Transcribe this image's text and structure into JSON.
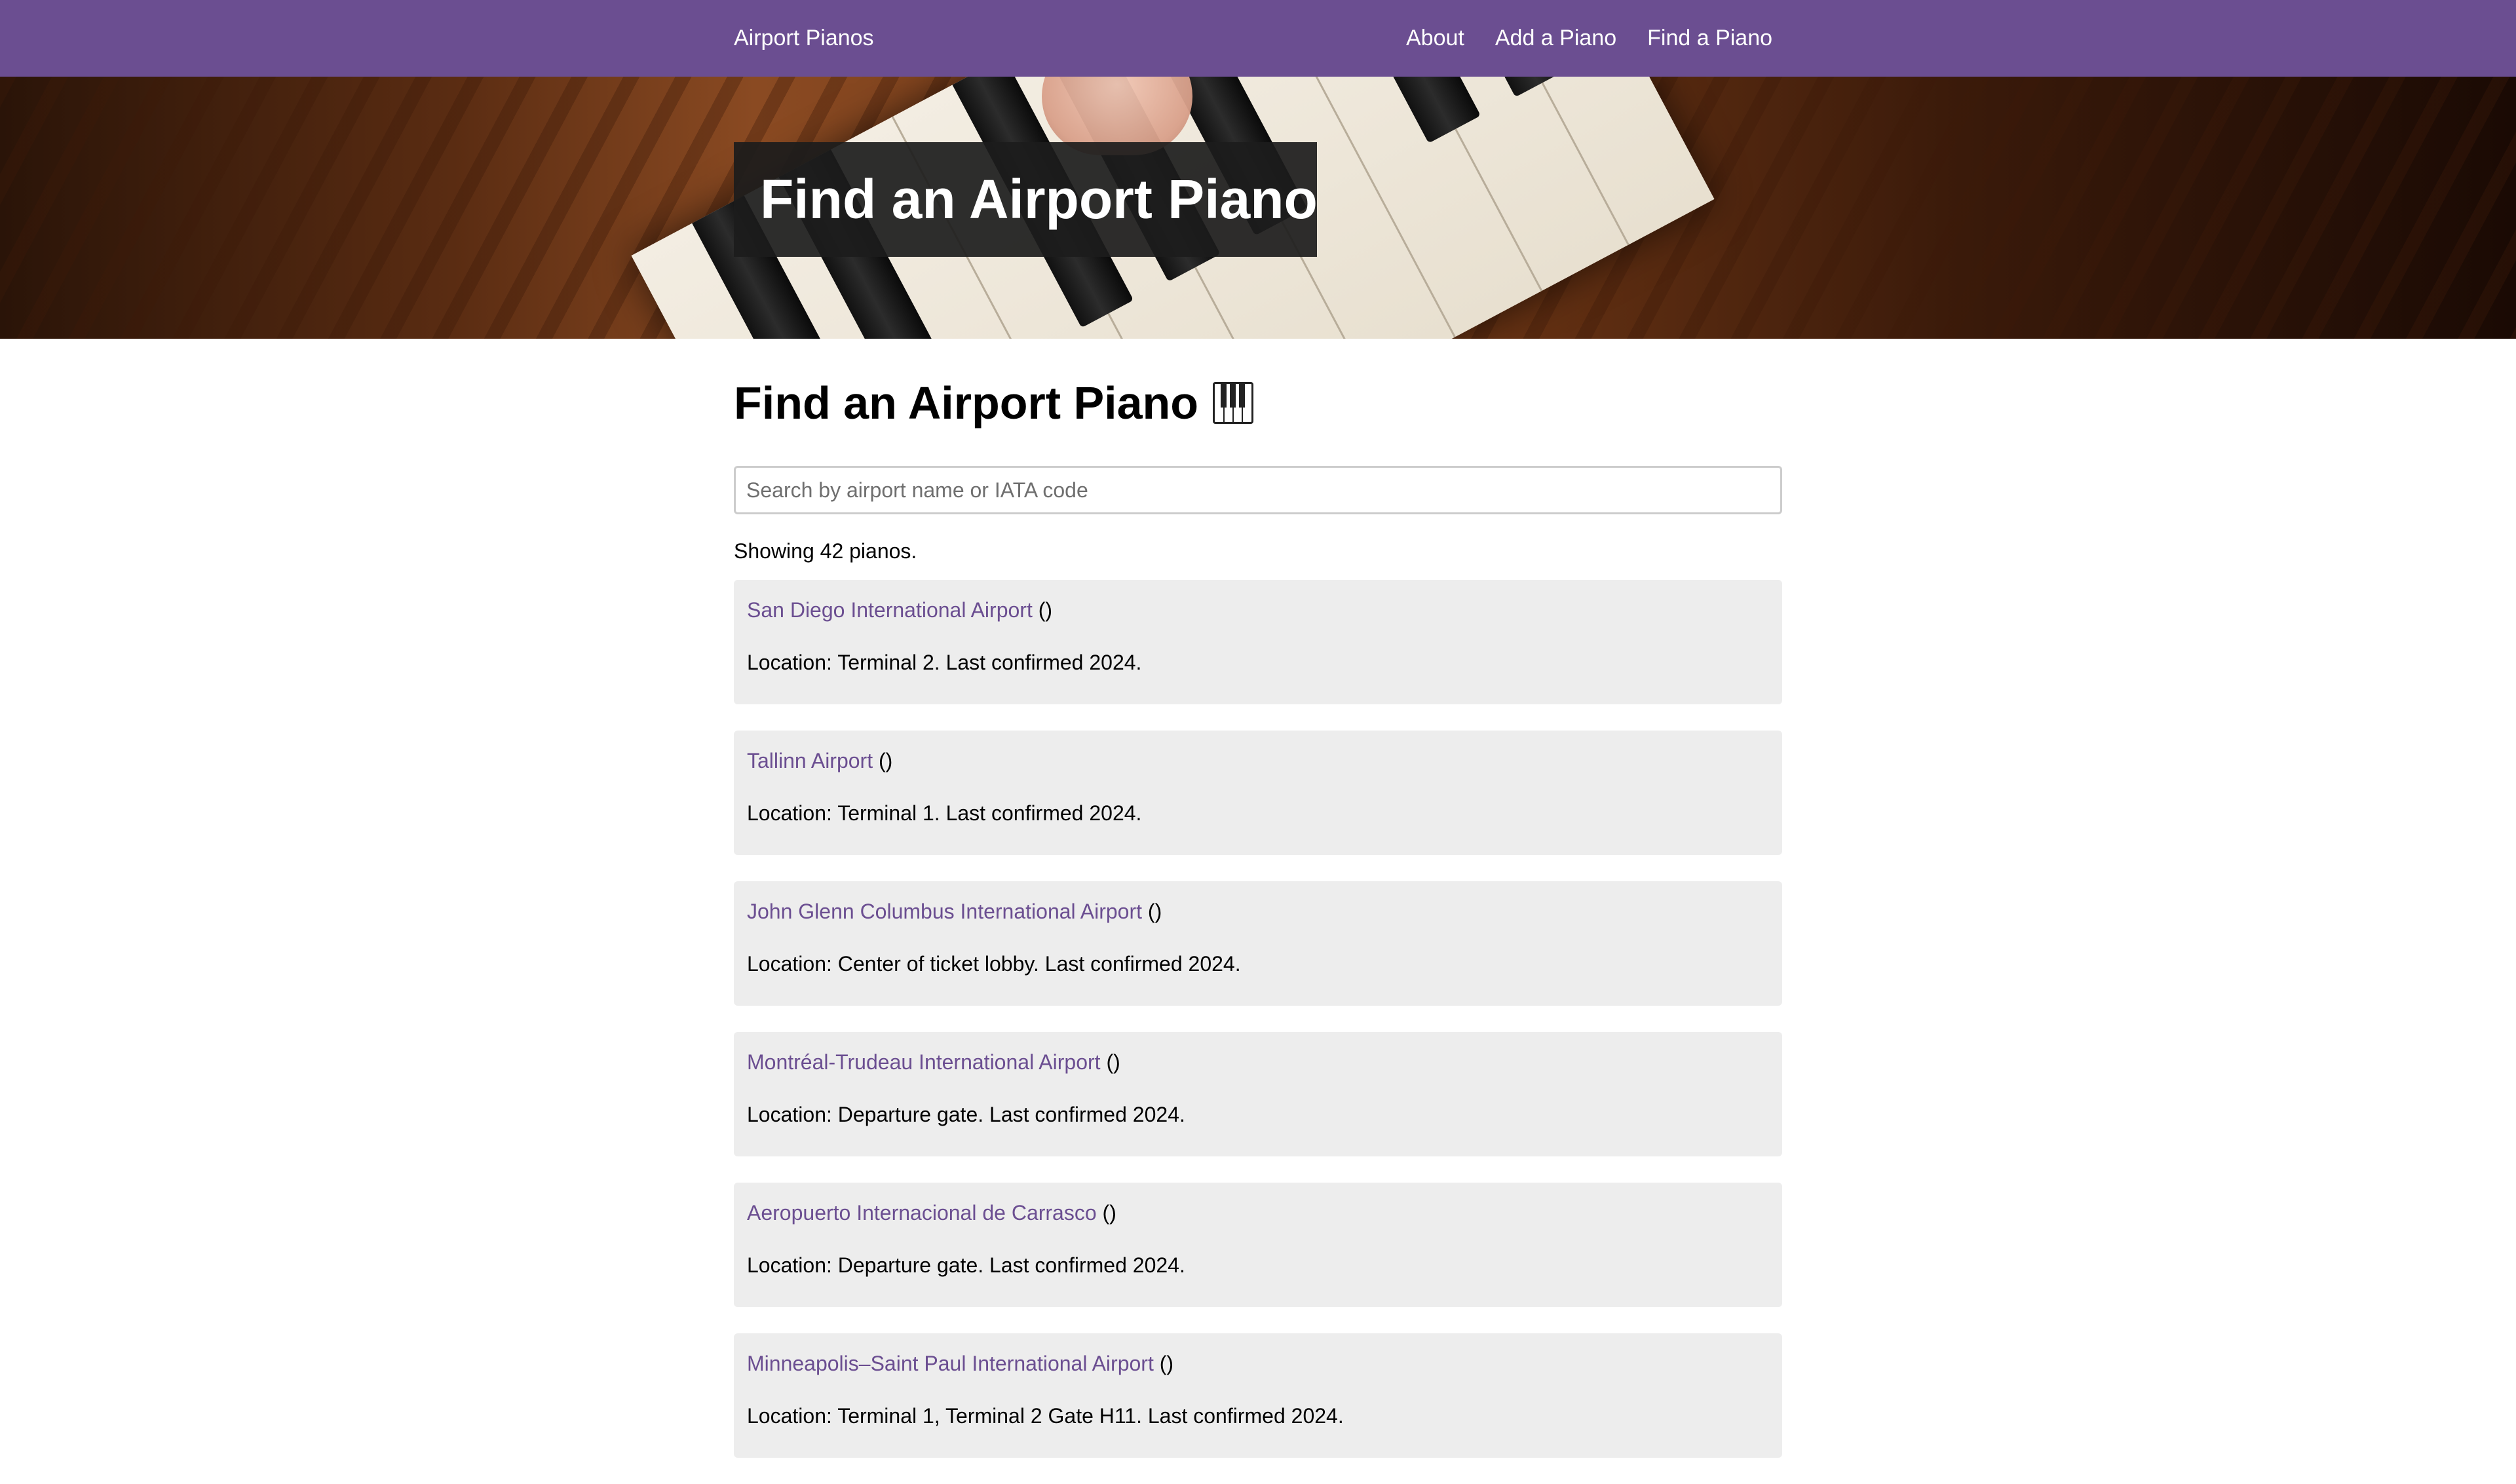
{
  "nav": {
    "brand": "Airport Pianos",
    "links": [
      {
        "label": "About"
      },
      {
        "label": "Add a Piano"
      },
      {
        "label": "Find a Piano"
      }
    ]
  },
  "hero": {
    "title": "Find an Airport Piano"
  },
  "main": {
    "title": "Find an Airport Piano",
    "title_icon": "piano-keys-icon",
    "search": {
      "placeholder": "Search by airport name or IATA code",
      "value": ""
    },
    "results_text": "Showing 42 pianos.",
    "pianos": [
      {
        "name": "San Diego International Airport",
        "code": "()",
        "location": "Location: Terminal 2. Last confirmed 2024."
      },
      {
        "name": "Tallinn Airport",
        "code": "()",
        "location": "Location: Terminal 1. Last confirmed 2024."
      },
      {
        "name": "John Glenn Columbus International Airport",
        "code": "()",
        "location": "Location: Center of ticket lobby. Last confirmed 2024."
      },
      {
        "name": "Montréal-Trudeau International Airport",
        "code": "()",
        "location": "Location: Departure gate. Last confirmed 2024."
      },
      {
        "name": "Aeropuerto Internacional de Carrasco",
        "code": "()",
        "location": "Location: Departure gate. Last confirmed 2024."
      },
      {
        "name": "Minneapolis–Saint Paul International Airport",
        "code": "()",
        "location": "Location: Terminal 1, Terminal 2 Gate H11. Last confirmed 2024."
      }
    ]
  },
  "colors": {
    "navbar": "#6b4e91",
    "link": "#6b4e91",
    "card": "#ededed"
  }
}
